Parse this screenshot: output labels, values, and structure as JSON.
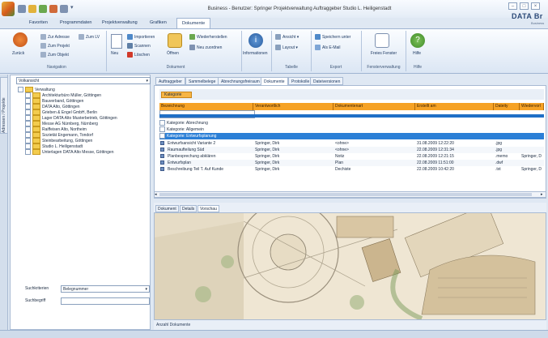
{
  "window": {
    "title": "Business - Benutzer: Springer Projektverwaltung Auftraggeber Studio L. Heiligenstadt",
    "brand": "DATA Br",
    "brand_sub": "Business"
  },
  "ribbon": {
    "tabs": [
      {
        "label": "Favoriten",
        "active": false
      },
      {
        "label": "Programmdaten",
        "active": false
      },
      {
        "label": "Projektverwaltung",
        "active": false
      },
      {
        "label": "Grafiken",
        "active": false
      },
      {
        "label": "Dokumente",
        "active": true
      }
    ],
    "navigation": {
      "back": "Zurück",
      "links": [
        "Zur Adresse",
        "Zum Projekt",
        "Zum Objekt"
      ],
      "lv": "Zum LV",
      "label": "Navigation"
    },
    "document": {
      "new": "Neu",
      "import": "Importieren",
      "scan": "Scannen",
      "delete": "Löschen",
      "open": "Öffnen",
      "restore": "Wiederherstellen",
      "new_assign": "Neu zuordnen",
      "label": "Dokument"
    },
    "info": {
      "label": "Informationen"
    },
    "tabelle": {
      "ansicht": "Ansicht",
      "layout": "Layout",
      "label": "Tabelle"
    },
    "export": {
      "save_under": "Speichern unter",
      "as_email": "Als E-Mail",
      "label": "Export"
    },
    "window_group": {
      "free": "Freies Fenster",
      "label": "Fensterverwaltung"
    },
    "help": {
      "help": "Hilfe",
      "label": "Hilfe"
    }
  },
  "left": {
    "dock_label": "Adressen / Projekte",
    "select": "Volkansicht",
    "tree": [
      {
        "label": "Verwaltung",
        "level": 0
      },
      {
        "label": "Architekturbüro Müller, Göttingen",
        "level": 1
      },
      {
        "label": "Bauverband, Göttingen",
        "level": 1
      },
      {
        "label": "DATA Alto, Göttingen",
        "level": 1
      },
      {
        "label": "Grieben & Engel GmbH, Berlin",
        "level": 1
      },
      {
        "label": "Lager DATA Alto Musterbetrieb, Göttingen",
        "level": 1
      },
      {
        "label": "Messe AG Nürnberg, Nürnberg",
        "level": 1
      },
      {
        "label": "Raiffeisen Alto, Northeim",
        "level": 1
      },
      {
        "label": "Sozietät Engemann, Tondorf",
        "level": 1
      },
      {
        "label": "Steinbearbeitung, Göttingen",
        "level": 1
      },
      {
        "label": "Studio L. Heiligenstadt",
        "level": 1
      },
      {
        "label": "Unterlagen DATA Alto Messe, Göttingen",
        "level": 1
      }
    ],
    "filter1_label": "Suchkriterien",
    "filter1_value": "Belegnummer",
    "filter2_label": "Suchbegriff"
  },
  "right": {
    "tabs": [
      {
        "label": "Auftraggeber",
        "active": false
      },
      {
        "label": "Sammelbelege",
        "active": false
      },
      {
        "label": "Abrechnungsfreiraum",
        "active": false
      },
      {
        "label": "Dokumente",
        "active": true
      },
      {
        "label": "Protokolle",
        "active": false
      },
      {
        "label": "Dateiversionen",
        "active": false
      }
    ],
    "group_chip": "Kategorie",
    "columns": [
      "Bezeichnung",
      "Verantwortlich",
      "Dokumentenart",
      "Erstellt am",
      "Dateity",
      "Wiedervorl"
    ],
    "groups": [
      {
        "label": "Kategorie: Abrechnung",
        "selected": false
      },
      {
        "label": "Kategorie: Allgemein",
        "selected": false
      },
      {
        "label": "Kategorie: Entwurfsplanung",
        "selected": true
      }
    ],
    "rows": [
      [
        "Entwurfsansicht Variante 2",
        "Springer, Dirk",
        "<ohne>",
        "31.08.2009 12:22:20",
        ".jpg",
        ""
      ],
      [
        "Raumaufteilung Süd",
        "Springer, Dirk",
        "<ohne>",
        "22.08.2009 12:31:34",
        ".jpg",
        ""
      ],
      [
        "Planbesprechung abklären",
        "Springer, Dirk",
        "Notiz",
        "22.08.2009 12:21:15",
        ".memo",
        "Springer, D"
      ],
      [
        "Entwurfsplan",
        "Springer, Dirk",
        "Plan",
        "22.08.2009 11:51:00",
        ".dwf",
        ""
      ],
      [
        "Beschreibung Teil T. Auf Kunde",
        "Springer, Dirk",
        "Dechiste",
        "22.08.2009 10:42:20",
        ".txt",
        "Springer, D"
      ]
    ],
    "preview_tabs": [
      {
        "label": "Dokument",
        "active": false
      },
      {
        "label": "Details",
        "active": false
      },
      {
        "label": "Vorschau",
        "active": true
      }
    ],
    "status": "Anzahl Dokumente"
  }
}
